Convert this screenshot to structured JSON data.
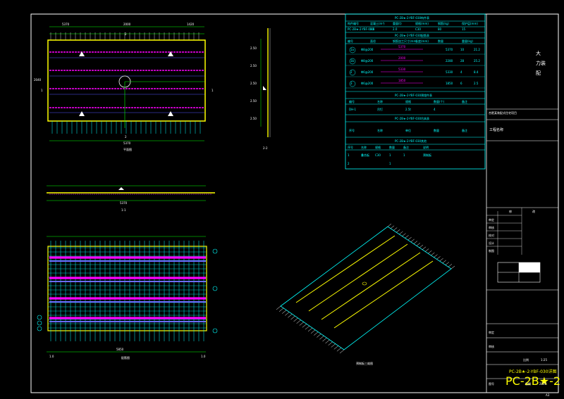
{
  "drawing": {
    "plan_view_label": "平面图",
    "section_label": "1-1",
    "section_2_label": "2-2",
    "rebar_view_label": "配筋图",
    "iso_view_label": "预制板三维图",
    "dim_total_plan": "5370",
    "dim_side": "2000",
    "dim_bottom_rebar": "5850",
    "corner_mark": "A3"
  },
  "tables": {
    "table1_title": "PC-2B★-2-YBF-030构件表",
    "table1_headers": [
      "构件编号",
      "混凝土(m³)",
      "重量(t)",
      "规格(mm)",
      "钢筋(kg)",
      "保护层(mm)"
    ],
    "table1_row": [
      "PC-2B★-2-YBF-030",
      "0.8",
      "2.0",
      "C30",
      "80",
      "15"
    ],
    "table2_title": "PC-2B★-2-YBF-030配筋表",
    "table2_headers": [
      "编号",
      "直径",
      "钢筋加工尺寸(mm)",
      "长度(mm)",
      "数量",
      "重量(kg)"
    ],
    "table2_rows": [
      {
        "id": "1a",
        "d": "Φ8@200",
        "shape": "5370",
        "len": "5370",
        "n": "10",
        "w": "21.2"
      },
      {
        "id": "1b",
        "d": "Φ8@200",
        "shape": "2000",
        "len": "2280",
        "n": "28",
        "w": "25.2"
      },
      {
        "id": "2",
        "d": "Φ6@200",
        "shape": "5330",
        "len": "5330",
        "n": "4",
        "w": "8.4"
      },
      {
        "id": "3",
        "d": "Φ6@200",
        "shape": "1850",
        "len": "1850",
        "n": "6",
        "w": "2.5"
      }
    ],
    "table3_title": "PC-2B★-2-YBF-030预埋件表",
    "table3_headers": [
      "编号",
      "名称",
      "规格",
      "数量(个)",
      "备注"
    ],
    "table3_row": [
      "DH-1",
      "吊钉",
      "2.5t",
      "4",
      ""
    ],
    "table4_title": "PC-2B★-2-YBF-030吊具表",
    "table4_row": [
      "序号",
      "名称",
      "单位",
      "数量",
      "备注"
    ],
    "table5_title": "PC-2B★-2-YBF-030其他",
    "table5_headers": [
      "序号",
      "名称",
      "规格",
      "数量",
      "备注",
      "说明"
    ],
    "table5_rows": [
      [
        "1",
        "叠合板",
        "C30",
        "1",
        "1",
        "预制板"
      ],
      [
        "2",
        "",
        "",
        "1",
        "",
        ""
      ]
    ]
  },
  "title_block": {
    "stamp_chars": [
      "大",
      "力",
      "装",
      "配"
    ],
    "project_label": "工程名称",
    "project_caption": "合肥某装配式住宅项目",
    "revision_header": [
      "修",
      "改"
    ],
    "sign_rows": [
      "审定",
      "审核",
      "校对",
      "设计",
      "制图"
    ],
    "scale_label": "比例",
    "scale_value": "1:25",
    "drawing_no_label": "图号",
    "drawing_no_value": "PC-2B★-2-YBF-030详图",
    "date_label": "日期",
    "date_value": "2022",
    "footer_left": "图号",
    "footer_mid": "PC-2B★-2",
    "sheet_label": "共1张"
  },
  "colors": {
    "background": "#000000",
    "line_white": "#ffffff",
    "line_cyan": "#00ffff",
    "line_yellow": "#ffff00",
    "line_green": "#00ff00",
    "line_magenta": "#ff00ff"
  }
}
